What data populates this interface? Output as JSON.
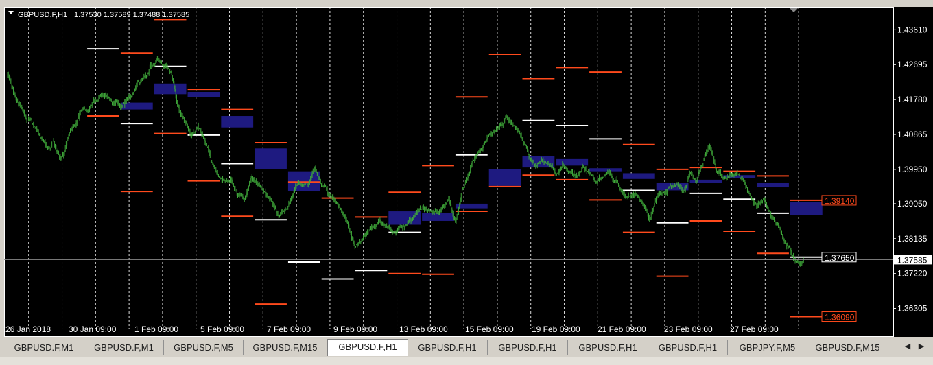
{
  "header": {
    "symbol": "GBPUSD.F,H1",
    "ohlc": "1.37530 1.37589 1.37488 1.37585"
  },
  "colors": {
    "background": "#000000",
    "candles": "#3fa83a",
    "pivot_white": "#ffffff",
    "pivot_red": "#ff4a1c",
    "zone_blue": "#1e1a80",
    "grid": "#ffffff",
    "axis_text": "#ffffff",
    "price_line": "#8a8a8a"
  },
  "chart_data": {
    "type": "candlestick",
    "symbol": "GBPUSD.F",
    "timeframe": "H1",
    "ylim": [
      1.3556,
      1.4421
    ],
    "y_ticks": [
      "1.43610",
      "1.42695",
      "1.41780",
      "1.40865",
      "1.39950",
      "1.39050",
      "1.38135",
      "1.37220",
      "1.36305"
    ],
    "x_ticks": [
      "26 Jan 2018",
      "30 Jan 09:00",
      "1 Feb 09:00",
      "5 Feb 09:00",
      "7 Feb 09:00",
      "9 Feb 09:00",
      "13 Feb 09:00",
      "15 Feb 09:00",
      "19 Feb 09:00",
      "21 Feb 09:00",
      "23 Feb 09:00",
      "27 Feb 09:00"
    ],
    "current_price": "1.37585",
    "level_labels": [
      {
        "text": "1.39140",
        "price": 1.3914,
        "color": "red"
      },
      {
        "text": "1.37650",
        "price": 1.3765,
        "color": "white"
      },
      {
        "text": "1.36090",
        "price": 1.3609,
        "color": "red"
      }
    ],
    "close_path": [
      [
        0,
        1.425
      ],
      [
        3,
        1.418
      ],
      [
        6,
        1.413
      ],
      [
        9,
        1.41
      ],
      [
        12,
        1.405
      ],
      [
        14,
        1.407
      ],
      [
        16,
        1.402
      ],
      [
        17,
        1.404
      ],
      [
        19,
        1.41
      ],
      [
        22,
        1.414
      ],
      [
        25,
        1.416
      ],
      [
        28,
        1.419
      ],
      [
        31,
        1.418
      ],
      [
        34,
        1.416
      ],
      [
        37,
        1.419
      ],
      [
        40,
        1.423
      ],
      [
        42,
        1.425
      ],
      [
        45,
        1.428
      ],
      [
        47,
        1.427
      ],
      [
        49,
        1.425
      ],
      [
        51,
        1.416
      ],
      [
        53,
        1.413
      ],
      [
        55,
        1.409
      ],
      [
        57,
        1.411
      ],
      [
        59,
        1.407
      ],
      [
        61,
        1.402
      ],
      [
        63,
        1.398
      ],
      [
        65,
        1.396
      ],
      [
        67,
        1.397
      ],
      [
        69,
        1.393
      ],
      [
        71,
        1.392
      ],
      [
        73,
        1.397
      ],
      [
        75,
        1.395
      ],
      [
        77,
        1.393
      ],
      [
        79,
        1.391
      ],
      [
        81,
        1.388
      ],
      [
        83,
        1.389
      ],
      [
        85,
        1.392
      ],
      [
        87,
        1.396
      ],
      [
        89,
        1.395
      ],
      [
        91,
        1.398
      ],
      [
        92,
        1.4
      ],
      [
        94,
        1.396
      ],
      [
        96,
        1.393
      ],
      [
        98,
        1.391
      ],
      [
        100,
        1.389
      ],
      [
        102,
        1.384
      ],
      [
        104,
        1.38
      ],
      [
        106,
        1.381
      ],
      [
        108,
        1.383
      ],
      [
        110,
        1.385
      ],
      [
        112,
        1.386
      ],
      [
        114,
        1.385
      ],
      [
        116,
        1.383
      ],
      [
        118,
        1.384
      ],
      [
        120,
        1.386
      ],
      [
        122,
        1.388
      ],
      [
        124,
        1.39
      ],
      [
        126,
        1.389
      ],
      [
        128,
        1.388
      ],
      [
        130,
        1.39
      ],
      [
        132,
        1.392
      ],
      [
        134,
        1.386
      ],
      [
        136,
        1.394
      ],
      [
        138,
        1.399
      ],
      [
        140,
        1.403
      ],
      [
        142,
        1.405
      ],
      [
        144,
        1.408
      ],
      [
        146,
        1.41
      ],
      [
        148,
        1.412
      ],
      [
        150,
        1.413
      ],
      [
        152,
        1.411
      ],
      [
        154,
        1.408
      ],
      [
        156,
        1.403
      ],
      [
        158,
        1.4
      ],
      [
        160,
        1.402
      ],
      [
        162,
        1.401
      ],
      [
        164,
        1.398
      ],
      [
        166,
        1.4
      ],
      [
        168,
        1.399
      ],
      [
        170,
        1.397
      ],
      [
        172,
        1.4
      ],
      [
        174,
        1.398
      ],
      [
        176,
        1.396
      ],
      [
        178,
        1.397
      ],
      [
        180,
        1.399
      ],
      [
        182,
        1.396
      ],
      [
        184,
        1.393
      ],
      [
        186,
        1.392
      ],
      [
        188,
        1.393
      ],
      [
        190,
        1.39
      ],
      [
        192,
        1.387
      ],
      [
        194,
        1.392
      ],
      [
        196,
        1.393
      ],
      [
        198,
        1.395
      ],
      [
        200,
        1.396
      ],
      [
        202,
        1.394
      ],
      [
        204,
        1.398
      ],
      [
        206,
        1.397
      ],
      [
        208,
        1.402
      ],
      [
        210,
        1.406
      ],
      [
        212,
        1.399
      ],
      [
        214,
        1.397
      ],
      [
        216,
        1.398
      ],
      [
        218,
        1.399
      ],
      [
        220,
        1.396
      ],
      [
        222,
        1.393
      ],
      [
        224,
        1.39
      ],
      [
        226,
        1.392
      ],
      [
        228,
        1.388
      ],
      [
        230,
        1.386
      ],
      [
        232,
        1.381
      ],
      [
        234,
        1.378
      ],
      [
        236,
        1.3755
      ],
      [
        237,
        1.3752
      ],
      [
        238,
        1.3758
      ]
    ],
    "pivot_levels": [
      {
        "c0": 24,
        "c1": 34,
        "price": 1.4311,
        "color": "white"
      },
      {
        "c0": 24,
        "c1": 34,
        "price": 1.4135,
        "color": "red"
      },
      {
        "c0": 34,
        "c1": 44,
        "price": 1.43,
        "color": "red"
      },
      {
        "c0": 34,
        "c1": 44,
        "price": 1.4115,
        "color": "white"
      },
      {
        "c0": 34,
        "c1": 44,
        "price": 1.3937,
        "color": "red"
      },
      {
        "c0": 44,
        "c1": 54,
        "price": 1.4388,
        "color": "red"
      },
      {
        "c0": 44,
        "c1": 54,
        "price": 1.4265,
        "color": "white"
      },
      {
        "c0": 44,
        "c1": 54,
        "price": 1.4089,
        "color": "red"
      },
      {
        "c0": 54,
        "c1": 64,
        "price": 1.4205,
        "color": "red"
      },
      {
        "c0": 54,
        "c1": 64,
        "price": 1.4085,
        "color": "white"
      },
      {
        "c0": 54,
        "c1": 64,
        "price": 1.3965,
        "color": "red"
      },
      {
        "c0": 64,
        "c1": 74,
        "price": 1.4152,
        "color": "red"
      },
      {
        "c0": 64,
        "c1": 74,
        "price": 1.401,
        "color": "white"
      },
      {
        "c0": 64,
        "c1": 74,
        "price": 1.3872,
        "color": "red"
      },
      {
        "c0": 74,
        "c1": 84,
        "price": 1.4065,
        "color": "red"
      },
      {
        "c0": 74,
        "c1": 84,
        "price": 1.3863,
        "color": "white"
      },
      {
        "c0": 74,
        "c1": 84,
        "price": 1.3642,
        "color": "red"
      },
      {
        "c0": 84,
        "c1": 94,
        "price": 1.3962,
        "color": "red"
      },
      {
        "c0": 84,
        "c1": 94,
        "price": 1.3752,
        "color": "white"
      },
      {
        "c0": 94,
        "c1": 104,
        "price": 1.392,
        "color": "red"
      },
      {
        "c0": 94,
        "c1": 104,
        "price": 1.3708,
        "color": "white"
      },
      {
        "c0": 104,
        "c1": 114,
        "price": 1.373,
        "color": "white"
      },
      {
        "c0": 104,
        "c1": 114,
        "price": 1.387,
        "color": "red"
      },
      {
        "c0": 114,
        "c1": 124,
        "price": 1.3935,
        "color": "red"
      },
      {
        "c0": 114,
        "c1": 124,
        "price": 1.383,
        "color": "white"
      },
      {
        "c0": 114,
        "c1": 124,
        "price": 1.3722,
        "color": "red"
      },
      {
        "c0": 124,
        "c1": 134,
        "price": 1.4005,
        "color": "red"
      },
      {
        "c0": 124,
        "c1": 134,
        "price": 1.372,
        "color": "red"
      },
      {
        "c0": 134,
        "c1": 144,
        "price": 1.4185,
        "color": "red"
      },
      {
        "c0": 134,
        "c1": 144,
        "price": 1.4033,
        "color": "white"
      },
      {
        "c0": 134,
        "c1": 144,
        "price": 1.3885,
        "color": "red"
      },
      {
        "c0": 144,
        "c1": 154,
        "price": 1.4297,
        "color": "red"
      },
      {
        "c0": 144,
        "c1": 154,
        "price": 1.395,
        "color": "red"
      },
      {
        "c0": 154,
        "c1": 164,
        "price": 1.4233,
        "color": "red"
      },
      {
        "c0": 154,
        "c1": 164,
        "price": 1.4123,
        "color": "white"
      },
      {
        "c0": 154,
        "c1": 164,
        "price": 1.398,
        "color": "red"
      },
      {
        "c0": 164,
        "c1": 174,
        "price": 1.4262,
        "color": "red"
      },
      {
        "c0": 164,
        "c1": 174,
        "price": 1.411,
        "color": "white"
      },
      {
        "c0": 164,
        "c1": 174,
        "price": 1.3968,
        "color": "red"
      },
      {
        "c0": 174,
        "c1": 184,
        "price": 1.425,
        "color": "red"
      },
      {
        "c0": 174,
        "c1": 184,
        "price": 1.4075,
        "color": "white"
      },
      {
        "c0": 174,
        "c1": 184,
        "price": 1.3915,
        "color": "red"
      },
      {
        "c0": 184,
        "c1": 194,
        "price": 1.406,
        "color": "red"
      },
      {
        "c0": 184,
        "c1": 194,
        "price": 1.394,
        "color": "white"
      },
      {
        "c0": 184,
        "c1": 194,
        "price": 1.383,
        "color": "red"
      },
      {
        "c0": 194,
        "c1": 204,
        "price": 1.3995,
        "color": "red"
      },
      {
        "c0": 194,
        "c1": 204,
        "price": 1.3855,
        "color": "white"
      },
      {
        "c0": 194,
        "c1": 204,
        "price": 1.3715,
        "color": "red"
      },
      {
        "c0": 204,
        "c1": 214,
        "price": 1.4,
        "color": "red"
      },
      {
        "c0": 204,
        "c1": 214,
        "price": 1.3932,
        "color": "white"
      },
      {
        "c0": 204,
        "c1": 214,
        "price": 1.386,
        "color": "red"
      },
      {
        "c0": 214,
        "c1": 224,
        "price": 1.399,
        "color": "red"
      },
      {
        "c0": 214,
        "c1": 224,
        "price": 1.3917,
        "color": "white"
      },
      {
        "c0": 214,
        "c1": 224,
        "price": 1.3833,
        "color": "red"
      },
      {
        "c0": 224,
        "c1": 234,
        "price": 1.3978,
        "color": "red"
      },
      {
        "c0": 224,
        "c1": 234,
        "price": 1.388,
        "color": "white"
      },
      {
        "c0": 224,
        "c1": 234,
        "price": 1.3775,
        "color": "red"
      },
      {
        "c0": 234,
        "c1": 244,
        "price": 1.3914,
        "color": "red"
      },
      {
        "c0": 234,
        "c1": 244,
        "price": 1.3765,
        "color": "white"
      },
      {
        "c0": 234,
        "c1": 244,
        "price": 1.3609,
        "color": "red"
      }
    ],
    "zones": [
      {
        "c0": 34,
        "c1": 44,
        "top": 1.417,
        "bottom": 1.4152
      },
      {
        "c0": 44,
        "c1": 54,
        "top": 1.422,
        "bottom": 1.4192
      },
      {
        "c0": 54,
        "c1": 64,
        "top": 1.4198,
        "bottom": 1.4185
      },
      {
        "c0": 64,
        "c1": 74,
        "top": 1.4135,
        "bottom": 1.4105
      },
      {
        "c0": 74,
        "c1": 84,
        "top": 1.405,
        "bottom": 1.3995
      },
      {
        "c0": 84,
        "c1": 94,
        "top": 1.399,
        "bottom": 1.3938
      },
      {
        "c0": 114,
        "c1": 124,
        "top": 1.3885,
        "bottom": 1.385
      },
      {
        "c0": 124,
        "c1": 134,
        "top": 1.388,
        "bottom": 1.386
      },
      {
        "c0": 134,
        "c1": 144,
        "top": 1.3905,
        "bottom": 1.3893
      },
      {
        "c0": 144,
        "c1": 154,
        "top": 1.3995,
        "bottom": 1.3952
      },
      {
        "c0": 154,
        "c1": 164,
        "top": 1.403,
        "bottom": 1.4
      },
      {
        "c0": 164,
        "c1": 174,
        "top": 1.4022,
        "bottom": 1.4005
      },
      {
        "c0": 174,
        "c1": 184,
        "top": 1.3998,
        "bottom": 1.399
      },
      {
        "c0": 184,
        "c1": 194,
        "top": 1.3985,
        "bottom": 1.397
      },
      {
        "c0": 194,
        "c1": 204,
        "top": 1.396,
        "bottom": 1.394
      },
      {
        "c0": 204,
        "c1": 214,
        "top": 1.3968,
        "bottom": 1.396
      },
      {
        "c0": 214,
        "c1": 224,
        "top": 1.398,
        "bottom": 1.3972
      },
      {
        "c0": 224,
        "c1": 234,
        "top": 1.396,
        "bottom": 1.3948
      },
      {
        "c0": 234,
        "c1": 244,
        "top": 1.391,
        "bottom": 1.3875
      }
    ]
  },
  "tabs": [
    {
      "label": "GBPUSD.F,M1",
      "active": false
    },
    {
      "label": "GBPUSD.F,M1",
      "active": false
    },
    {
      "label": "GBPUSD.F,M5",
      "active": false
    },
    {
      "label": "GBPUSD.F,M15",
      "active": false
    },
    {
      "label": "GBPUSD.F,H1",
      "active": true
    },
    {
      "label": "GBPUSD.F,H1",
      "active": false
    },
    {
      "label": "GBPUSD.F,H1",
      "active": false
    },
    {
      "label": "GBPUSD.F,H1",
      "active": false
    },
    {
      "label": "GBPUSD.F,H1",
      "active": false
    },
    {
      "label": "GBPJPY.F,M5",
      "active": false
    },
    {
      "label": "GBPUSD.F,M15",
      "active": false
    }
  ]
}
